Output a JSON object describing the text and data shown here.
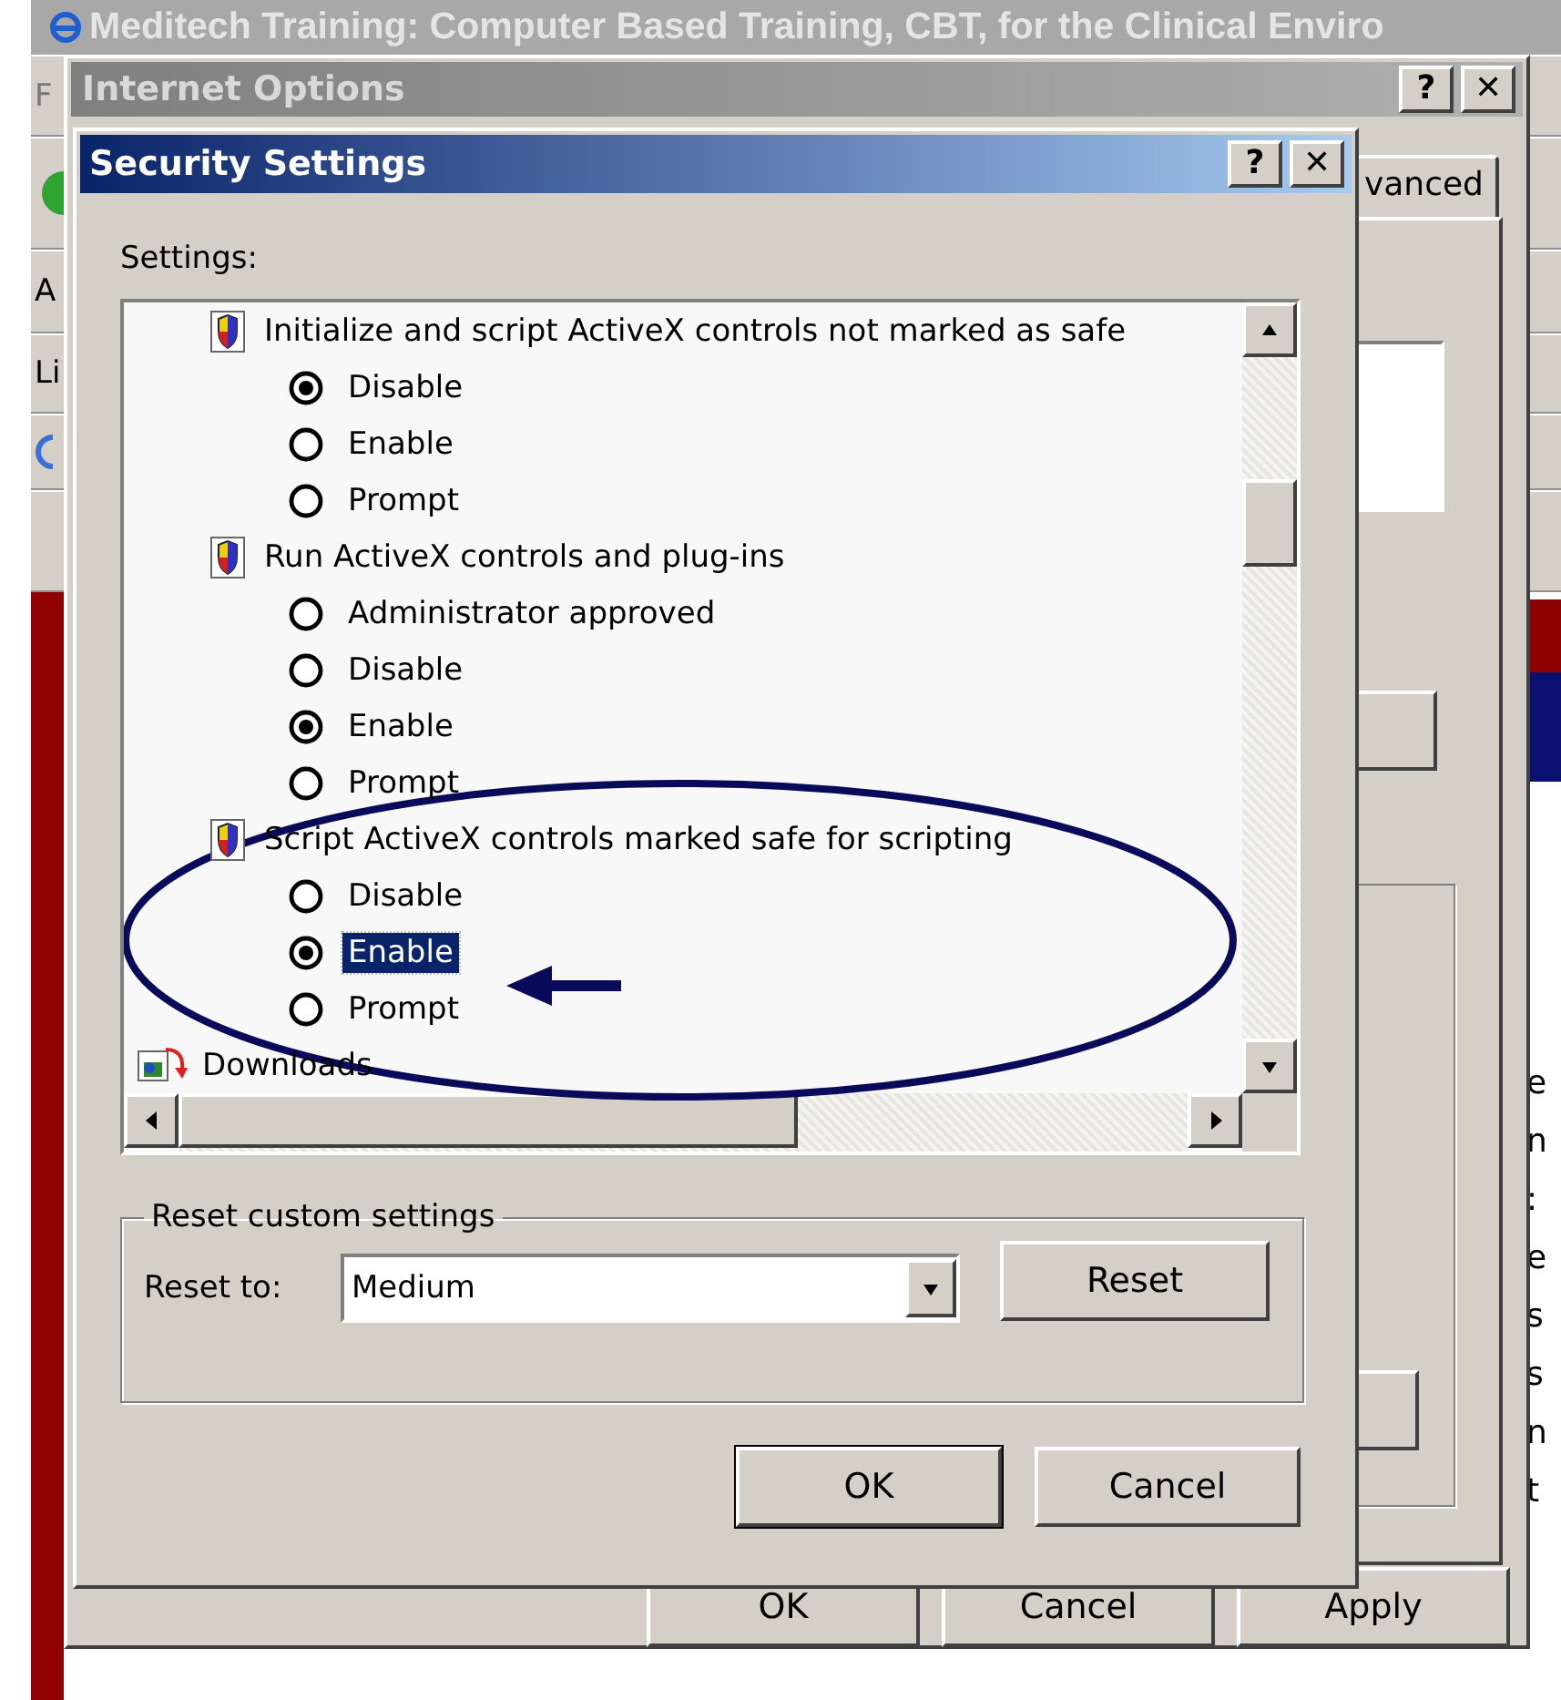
{
  "browser_window": {
    "title": "Meditech Training: Computer Based Training, CBT, for the Clinical Enviro",
    "toolbar_fragments": [
      "F",
      "A",
      "Li"
    ],
    "page_fragments": [
      "e",
      "n",
      ":",
      "e",
      "s",
      "s",
      "n",
      "t"
    ]
  },
  "internet_options": {
    "title": "Internet Options",
    "title_buttons": [
      "?",
      "✕"
    ],
    "tab": {
      "label": "vanced",
      "selected": true
    },
    "buttons": [
      "OK",
      "Cancel",
      "Apply"
    ]
  },
  "security_settings": {
    "title": "Security Settings",
    "title_buttons": [
      "?",
      "✕"
    ],
    "settings_label": "Settings:",
    "list": [
      {
        "kind": "setting",
        "label": "Initialize and script ActiveX controls not marked as safe",
        "children": [
          {
            "label": "Disable",
            "selected": true,
            "highlighted": false
          },
          {
            "label": "Enable",
            "selected": false,
            "highlighted": false
          },
          {
            "label": "Prompt",
            "selected": false,
            "highlighted": false
          }
        ]
      },
      {
        "kind": "setting",
        "label": "Run ActiveX controls and plug-ins",
        "children": [
          {
            "label": "Administrator approved",
            "selected": false,
            "highlighted": false
          },
          {
            "label": "Disable",
            "selected": false,
            "highlighted": false
          },
          {
            "label": "Enable",
            "selected": true,
            "highlighted": false
          },
          {
            "label": "Prompt",
            "selected": false,
            "highlighted": false
          }
        ]
      },
      {
        "kind": "setting",
        "label": "Script ActiveX controls marked safe for scripting",
        "children": [
          {
            "label": "Disable",
            "selected": false,
            "highlighted": false
          },
          {
            "label": "Enable",
            "selected": true,
            "highlighted": true
          },
          {
            "label": "Prompt",
            "selected": false,
            "highlighted": false
          }
        ]
      },
      {
        "kind": "category",
        "label": "Downloads"
      }
    ],
    "reset_group": {
      "legend": "Reset custom settings",
      "reset_to_label": "Reset to:",
      "reset_to_value": "Medium",
      "reset_button": "Reset"
    },
    "buttons": [
      "OK",
      "Cancel"
    ]
  }
}
